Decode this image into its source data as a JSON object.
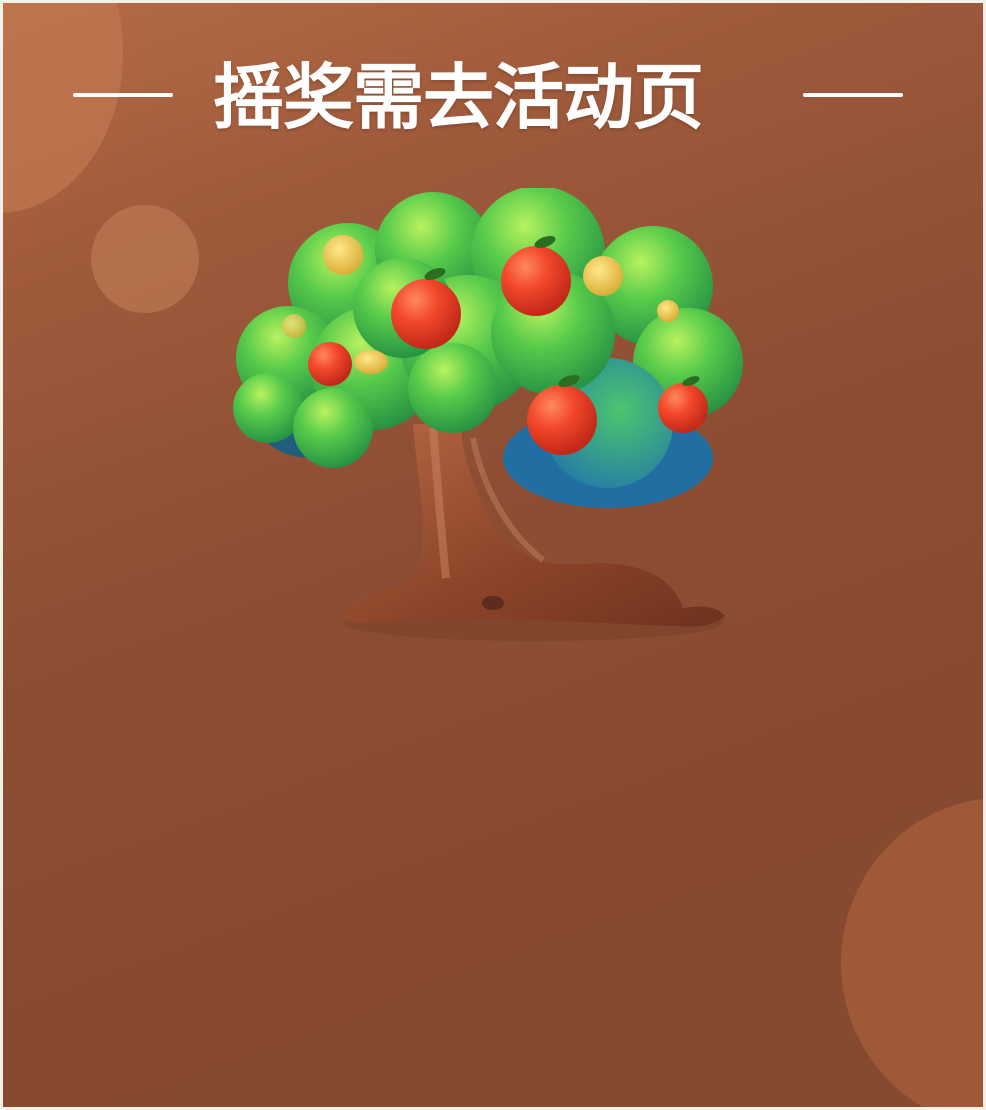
{
  "page": {
    "title": "摇奖需去活动页"
  },
  "colors": {
    "background": "#874a30",
    "title": "#ffffff",
    "foliage": "#56c94c",
    "fruit": "#ef4c2c",
    "coin": "#e5c247",
    "trunk": "#9a4f33"
  },
  "illustration": {
    "name": "money-tree",
    "fruit_icon": "orange-icon",
    "coin_icon": "gold-coin-icon"
  }
}
